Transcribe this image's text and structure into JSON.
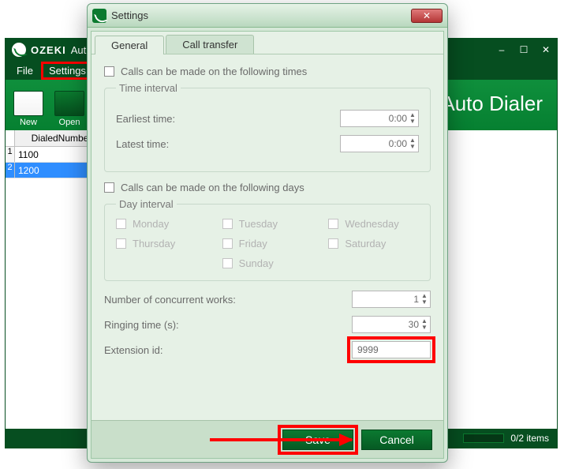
{
  "main": {
    "brand": "OZEKI",
    "title_suffix": "Aut",
    "tool_title": "Auto Dialer",
    "menu": {
      "file": "File",
      "settings": "Settings"
    },
    "toolbar": {
      "new": "New",
      "open": "Open"
    },
    "status": {
      "items": "0/2 items"
    },
    "sheet": {
      "header": "DialedNumber",
      "rows": [
        {
          "n": "1",
          "val": "1100"
        },
        {
          "n": "2",
          "val": "1200"
        }
      ]
    }
  },
  "dialog": {
    "title": "Settings",
    "tabs": {
      "general": "General",
      "call_transfer": "Call transfer"
    },
    "times_chk": "Calls can be made on the following times",
    "time_interval": {
      "legend": "Time interval",
      "earliest_label": "Earliest time:",
      "earliest_value": "0:00",
      "latest_label": "Latest time:",
      "latest_value": "0:00"
    },
    "days_chk": "Calls can be made on the following days",
    "day_interval": {
      "legend": "Day interval",
      "mon": "Monday",
      "tue": "Tuesday",
      "wed": "Wednesday",
      "thu": "Thursday",
      "fri": "Friday",
      "sat": "Saturday",
      "sun": "Sunday"
    },
    "concurrent_label": "Number of concurrent works:",
    "concurrent_value": "1",
    "ring_label": "Ringing time (s):",
    "ring_value": "30",
    "ext_label": "Extension id:",
    "ext_value": "9999",
    "save": "Save",
    "cancel": "Cancel"
  }
}
